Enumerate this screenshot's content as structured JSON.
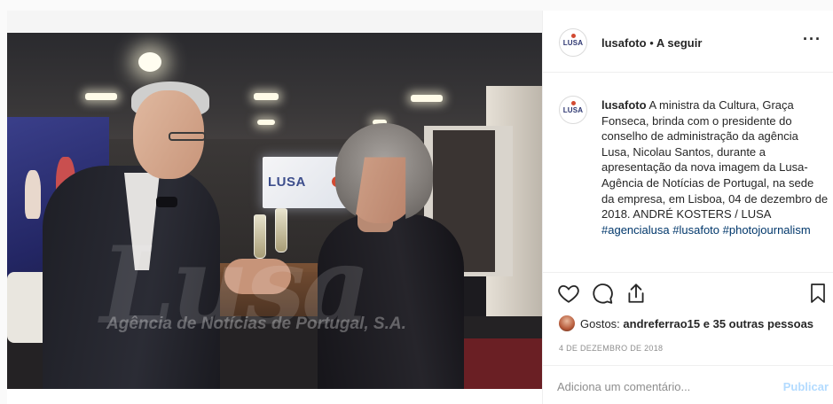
{
  "post": {
    "username": "lusafoto",
    "separator": "•",
    "follow_label": "A seguir",
    "more_label": "···",
    "avatar_logo": "LUSA"
  },
  "photo": {
    "screen_text": "LUSA",
    "watermark": "Lusa",
    "watermark_sub": "Agência de Notícias de Portugal, S.A."
  },
  "caption": {
    "username": "lusafoto",
    "text": " A ministra da Cultura, Graça Fonseca, brinda com o presidente do conselho de administração da agência Lusa, Nicolau Santos, durante a apresentação da nova imagem da Lusa-Agência de Notícias de Portugal, na sede da empresa, em Lisboa, 04 de dezembro de 2018. ANDRÉ KOSTERS / LUSA ",
    "hashtags": [
      "#agencialusa",
      "#lusafoto",
      "#photojournalism"
    ]
  },
  "actions": {
    "like_icon": "heart-icon",
    "comment_icon": "comment-icon",
    "share_icon": "share-icon",
    "save_icon": "bookmark-icon"
  },
  "likes": {
    "prefix": "Gostos: ",
    "text": "andreferrao15 e 35 outras pessoas"
  },
  "date": "4 DE DEZEMBRO DE 2018",
  "comment": {
    "placeholder": "Adiciona um comentário...",
    "publish_label": "Publicar"
  },
  "colors": {
    "hashtag": "#00376b",
    "publish_disabled": "#b3dbff",
    "brand_blue": "#2c3570",
    "brand_red": "#d24a32"
  }
}
